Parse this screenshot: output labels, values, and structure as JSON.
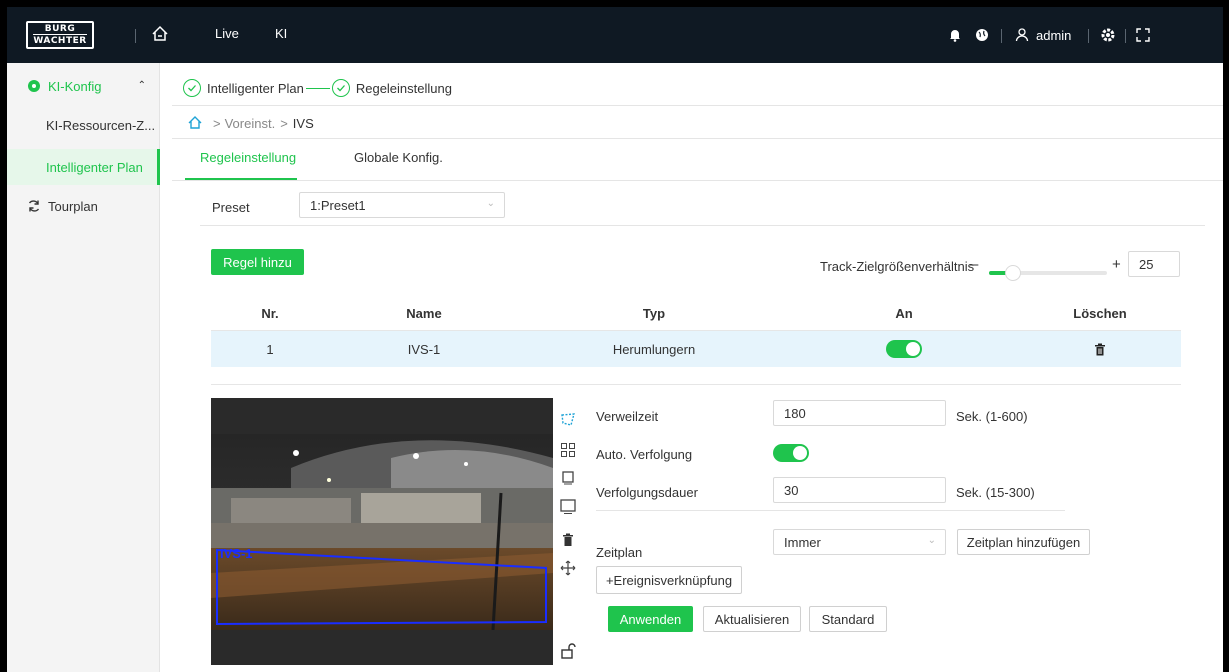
{
  "topbar": {
    "logo_line1": "BURG",
    "logo_line2": "WACHTER",
    "nav": [
      {
        "label": "Live"
      },
      {
        "label": "KI"
      }
    ],
    "user": "admin"
  },
  "sidebar": {
    "group_label": "KI-Konfig",
    "items": [
      {
        "label": "KI-Ressourcen-Z..."
      },
      {
        "label": "Intelligenter Plan"
      }
    ],
    "tour_label": "Tourplan"
  },
  "steps": [
    "Intelligenter Plan",
    "Regeleinstellung"
  ],
  "breadcrumb": [
    "Voreinst.",
    "IVS"
  ],
  "tabs": [
    {
      "label": "Regeleinstellung"
    },
    {
      "label": "Globale Konfig."
    }
  ],
  "preset": {
    "label": "Preset",
    "value": "1:Preset1"
  },
  "add_rule_label": "Regel hinzu",
  "track_ratio": {
    "label": "Track-Zielgrößenverhältnis",
    "value": "25",
    "level_percent": 20
  },
  "table": {
    "headers": [
      "Nr.",
      "Name",
      "Typ",
      "An",
      "Löschen"
    ],
    "rows": [
      {
        "nr": "1",
        "name": "IVS-1",
        "typ": "Herumlungern",
        "on": true
      }
    ]
  },
  "video": {
    "overlay_label": "IVS-1"
  },
  "form": {
    "dwell_label": "Verweilzeit",
    "dwell_value": "180",
    "dwell_unit": "Sek. (1-600)",
    "auto_track_label": "Auto. Verfolgung",
    "track_duration_label": "Verfolgungsdauer",
    "track_duration_value": "30",
    "track_duration_unit": "Sek. (15-300)",
    "schedule_label": "Zeitplan",
    "schedule_value": "Immer",
    "add_schedule_label": "Zeitplan hinzufügen",
    "event_link_label": "+Ereignisverknüpfung"
  },
  "actions": {
    "apply": "Anwenden",
    "refresh": "Aktualisieren",
    "default": "Standard"
  },
  "colors": {
    "accent": "#1fc44d",
    "topbar": "#0f1923",
    "row_highlight": "#e6f4fc"
  }
}
